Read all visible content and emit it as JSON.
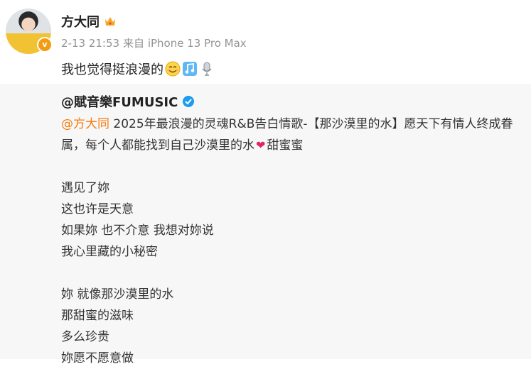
{
  "post": {
    "author": "方大同",
    "time": "2-13 21:53",
    "source": "来自 iPhone 13 Pro Max",
    "text": "我也觉得挺浪漫的",
    "emojis": [
      "smile-emoji-icon",
      "music-note-icon",
      "microphone-icon"
    ]
  },
  "repost": {
    "author": "@賦音樂FUMUSIC",
    "mention": "@方大同",
    "intro_text": " 2025年最浪漫的灵魂R&B告白情歌-【那沙漠里的水】愿天下有情人终成眷属，每个人都能找到自己沙漠里的水",
    "intro_tail": "甜蜜蜜",
    "lyrics_verse1": [
      "遇见了妳",
      "这也许是天意",
      "如果妳  也不介意  我想对妳说",
      "我心里藏的小秘密"
    ],
    "lyrics_verse2": [
      "妳  就像那沙漠里的水",
      "那甜蜜的滋味",
      "多么珍贵",
      "妳愿不愿意做"
    ]
  },
  "colors": {
    "mention": "#f77a0c",
    "repost_bg": "#f7f7f7",
    "meta": "#939393",
    "verified": "#1c9cf0"
  }
}
